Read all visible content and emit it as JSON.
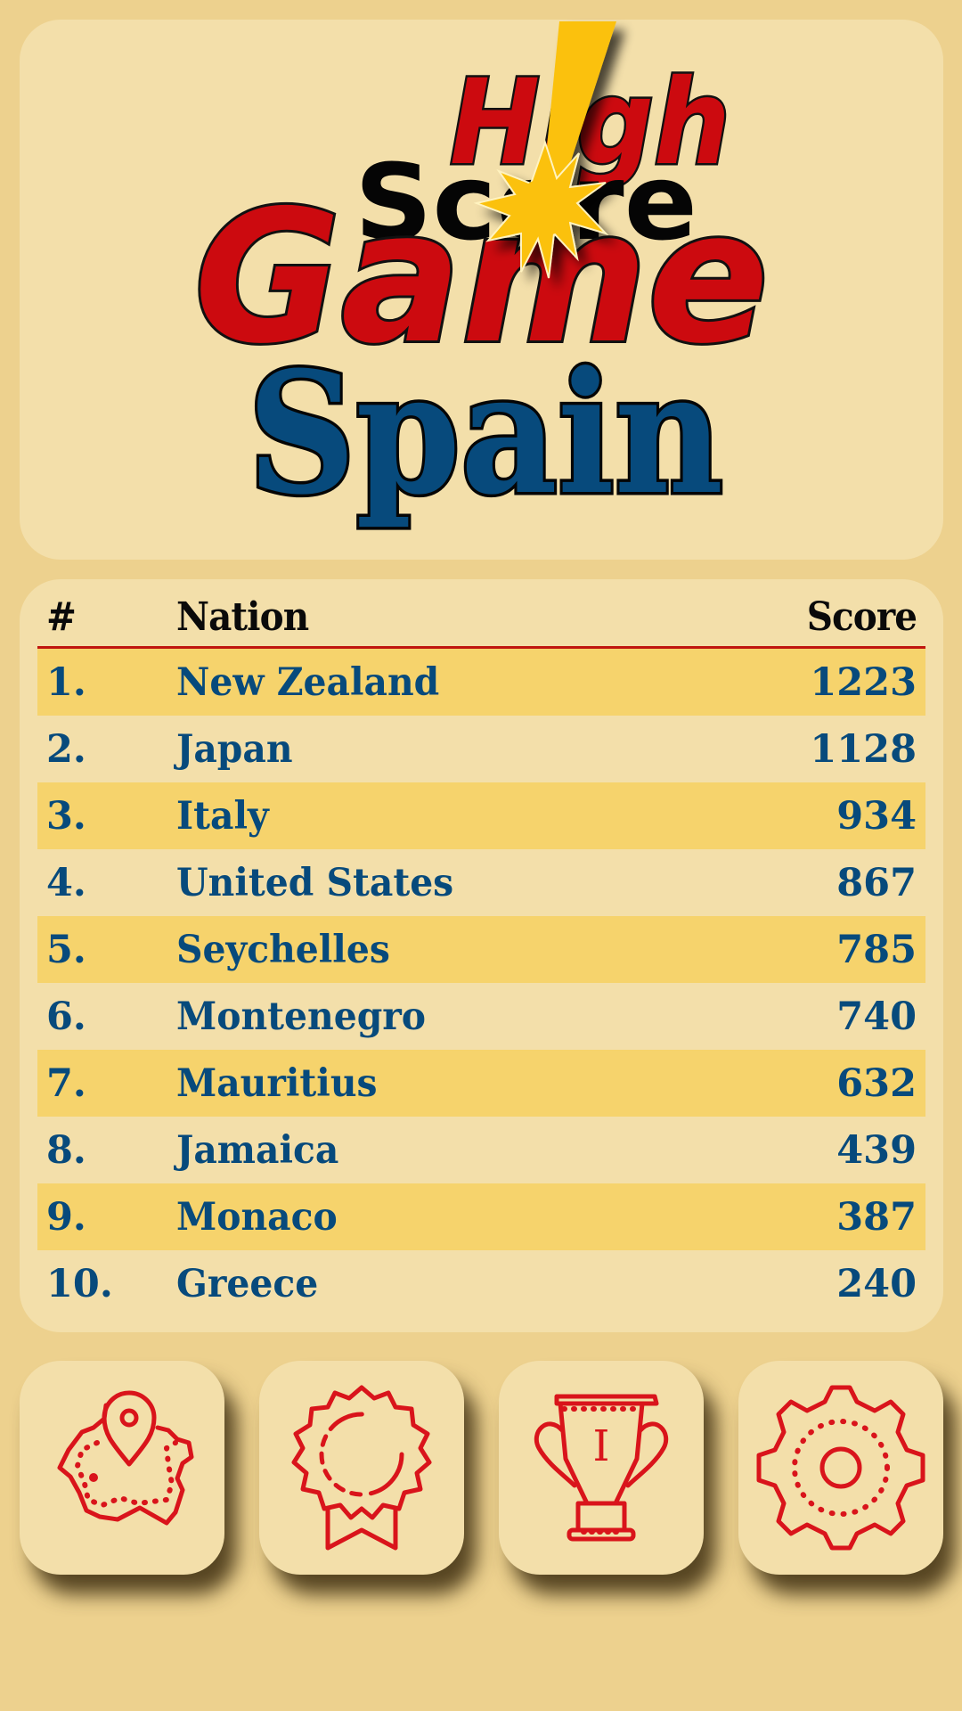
{
  "app": {
    "logo": {
      "line1": "High",
      "line2": "Score",
      "line3": "Game",
      "exclaim_icon": "exclamation-starburst-icon"
    },
    "country": "Spain"
  },
  "leaderboard": {
    "headers": {
      "rank": "#",
      "nation": "Nation",
      "score": "Score"
    },
    "rows": [
      {
        "rank": "1.",
        "nation": "New Zealand",
        "score": "1223"
      },
      {
        "rank": "2.",
        "nation": "Japan",
        "score": "1128"
      },
      {
        "rank": "3.",
        "nation": "Italy",
        "score": "934"
      },
      {
        "rank": "4.",
        "nation": "United States",
        "score": "867"
      },
      {
        "rank": "5.",
        "nation": "Seychelles",
        "score": "785"
      },
      {
        "rank": "6.",
        "nation": "Montenegro",
        "score": "740"
      },
      {
        "rank": "7.",
        "nation": "Mauritius",
        "score": "632"
      },
      {
        "rank": "8.",
        "nation": "Jamaica",
        "score": "439"
      },
      {
        "rank": "9.",
        "nation": "Monaco",
        "score": "387"
      },
      {
        "rank": "10.",
        "nation": "Greece",
        "score": "240"
      }
    ]
  },
  "nav": [
    {
      "id": "map",
      "icon": "country-map-pin-icon"
    },
    {
      "id": "awards",
      "icon": "award-ribbon-icon"
    },
    {
      "id": "trophy",
      "icon": "trophy-icon",
      "glyph": "I"
    },
    {
      "id": "settings",
      "icon": "gear-icon"
    }
  ],
  "colors": {
    "background": "#EDD18E",
    "card": "#F3DFAA",
    "row_highlight": "#F6D36C",
    "logo_red": "#CC0A0F",
    "spain_blue": "#074A7C",
    "accent_yellow": "#FBC10A",
    "divider_red": "#C0160F",
    "icon_red": "#D9141B"
  }
}
